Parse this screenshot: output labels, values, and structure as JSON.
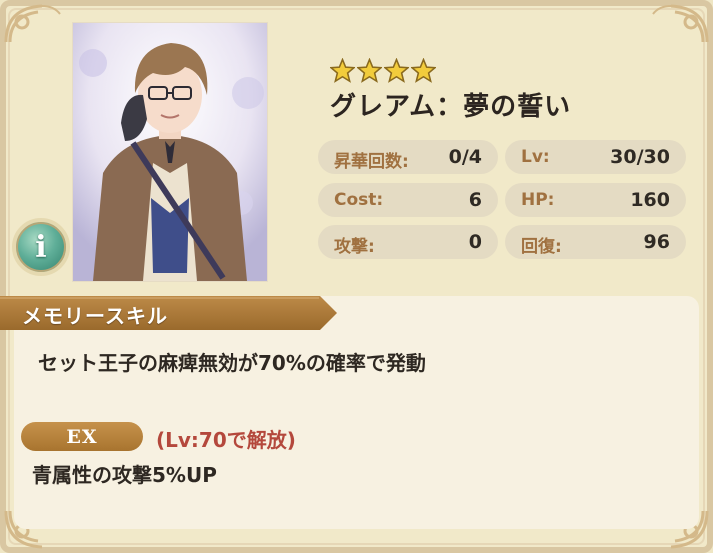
{
  "card": {
    "rarity_stars": 4,
    "name": "グレアム：夢の誓い",
    "stats": [
      {
        "key": "昇華回数:",
        "value": "0/4"
      },
      {
        "key": "Lv:",
        "value": "30/30"
      },
      {
        "key": "Cost:",
        "value": "6"
      },
      {
        "key": "HP:",
        "value": "160"
      },
      {
        "key": "攻撃:",
        "value": "0"
      },
      {
        "key": "回復:",
        "value": "96"
      }
    ]
  },
  "info_button": {
    "label": "i"
  },
  "memory_skill": {
    "header": "メモリースキル",
    "description": "セット王子の麻痺無効が70%の確率で発動",
    "ex_badge": "EX",
    "ex_unlock": "(Lv:70で解放)",
    "ex_effect": "青属性の攻撃5%UP"
  },
  "colors": {
    "background": "#f1e9c9",
    "stat_key": "#a07140",
    "ribbon": "#a8742f",
    "ex_unlock": "#b4483c",
    "info_button": "#5fae98"
  }
}
